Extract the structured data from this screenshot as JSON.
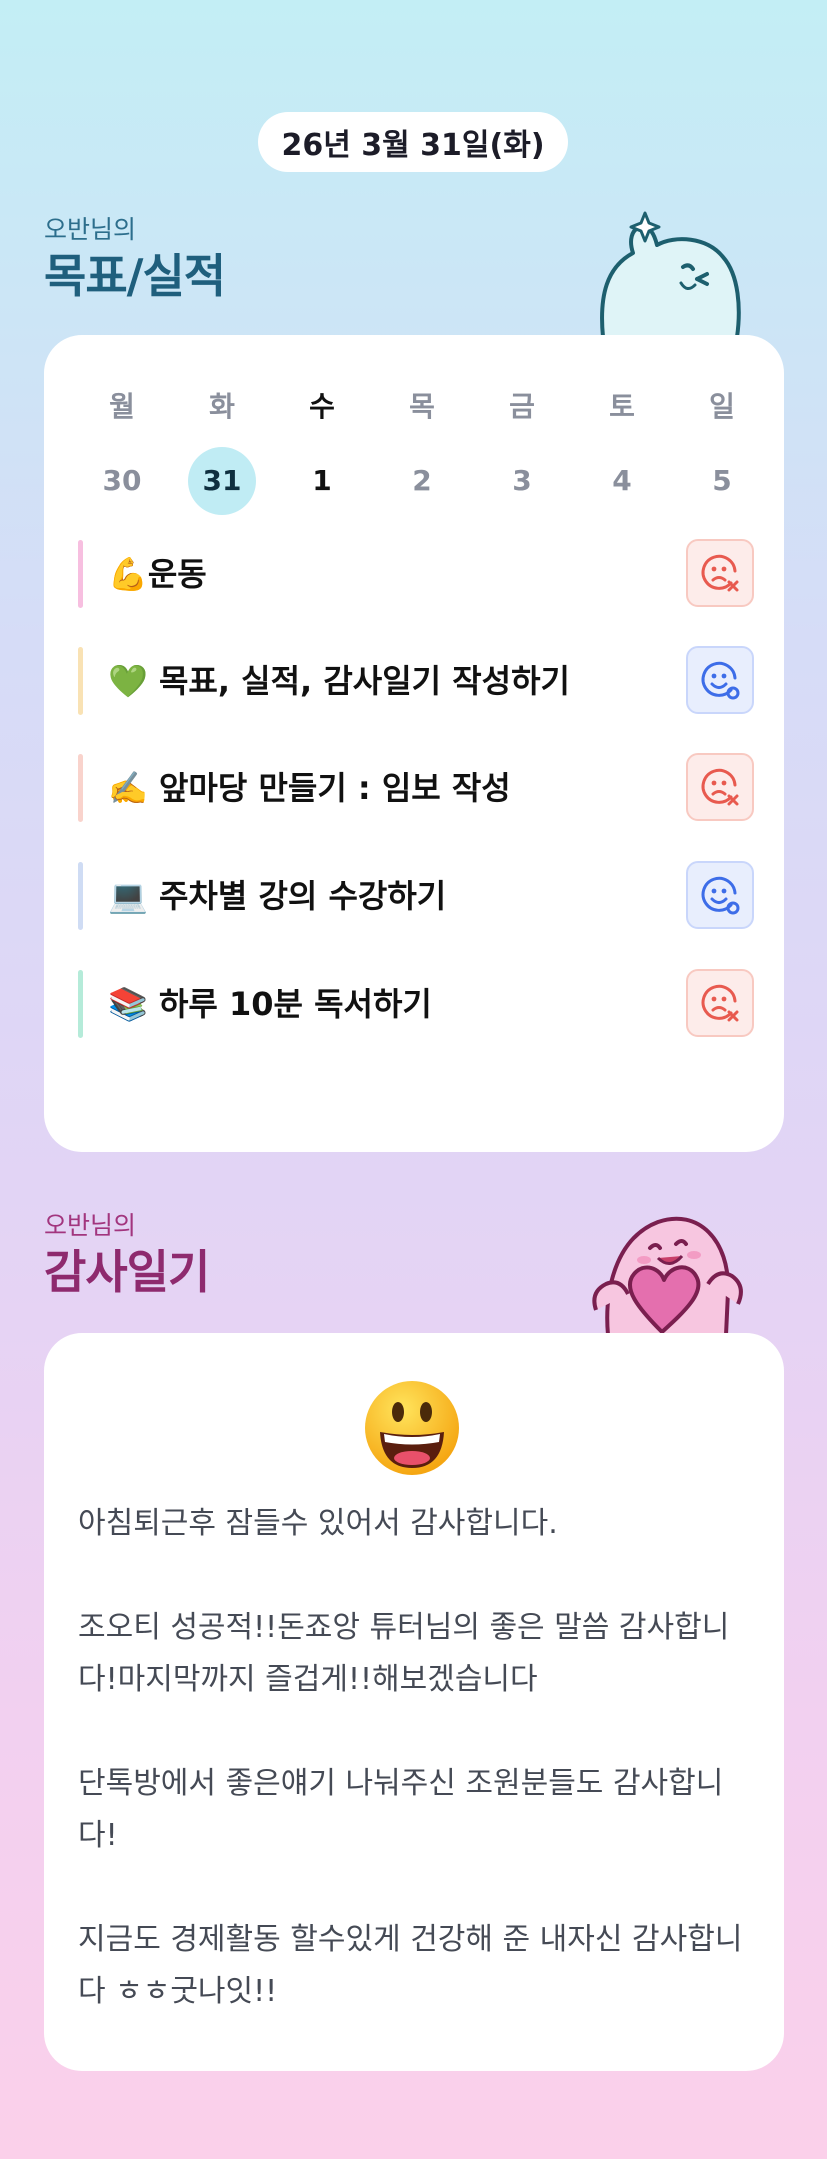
{
  "date_label": "26년 3월 31일(화)",
  "goals_section": {
    "owner": "오반님의",
    "title": "목표/실적"
  },
  "week": {
    "weekdays": [
      "월",
      "화",
      "수",
      "목",
      "금",
      "토",
      "일"
    ],
    "dates": [
      "30",
      "31",
      "1",
      "2",
      "3",
      "4",
      "5"
    ],
    "selected_index": 1,
    "today_index": 2
  },
  "goals": [
    {
      "label": "💪운동",
      "status": "fail",
      "status_icon": "sad-face-x-icon",
      "bar_color": "#f7bfe0"
    },
    {
      "label": "💚 목표, 실적, 감사일기 작성하기",
      "status": "done",
      "status_icon": "smile-face-check-icon",
      "bar_color": "#f9e2b4"
    },
    {
      "label": "✍️ 앞마당 만들기 : 임보 작성",
      "status": "fail",
      "status_icon": "sad-face-x-icon",
      "bar_color": "#f9d3cc"
    },
    {
      "label": "💻 주차별 강의 수강하기",
      "status": "done",
      "status_icon": "smile-face-check-icon",
      "bar_color": "#cfdcf4"
    },
    {
      "label": "📚 하루 10분 독서하기",
      "status": "fail",
      "status_icon": "sad-face-x-icon",
      "bar_color": "#b5ebd9"
    }
  ],
  "diary_section": {
    "owner": "오반님의",
    "title": "감사일기"
  },
  "diary": {
    "mood_icon": "grinning-face-icon",
    "paragraphs": [
      "아침퇴근후 잠들수 있어서 감사합니다.",
      "조오티 성공적!!돈죠앙 튜터님의 좋은 말씀 감사합니다!마지막까지 즐겁게!!해보겠습니다",
      "단톡방에서 좋은얘기 나눠주신 조원분들도 감사합니다!",
      "지금도 경제활동 할수있게 건강해 준 내자신 감사합니다 ㅎㅎ굿나잇!!"
    ]
  },
  "colors": {
    "goals_title": "#1f5f7d",
    "diary_title": "#8e2a6e",
    "selected_date_bg": "#c0ecf4",
    "fail_red": "#e85a4f",
    "done_blue": "#3d6de8"
  }
}
